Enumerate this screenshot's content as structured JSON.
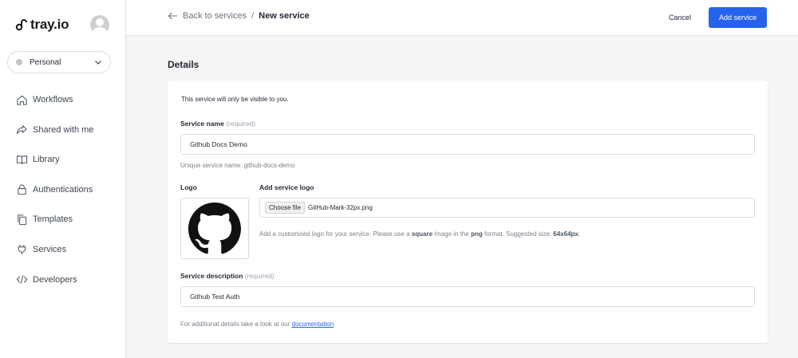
{
  "brand": {
    "name": "tray.io"
  },
  "workspace": {
    "label": "Personal"
  },
  "nav": {
    "items": [
      {
        "label": "Workflows",
        "icon": "home-icon"
      },
      {
        "label": "Shared with me",
        "icon": "share-icon"
      },
      {
        "label": "Library",
        "icon": "book-icon"
      },
      {
        "label": "Authentications",
        "icon": "lock-icon"
      },
      {
        "label": "Templates",
        "icon": "copy-icon"
      },
      {
        "label": "Services",
        "icon": "plug-icon"
      },
      {
        "label": "Developers",
        "icon": "code-icon"
      }
    ]
  },
  "header": {
    "back_label": "Back to services",
    "separator": "/",
    "current": "New service",
    "cancel_label": "Cancel",
    "add_label": "Add service"
  },
  "section": {
    "title": "Details"
  },
  "form": {
    "visibility_note": "This service will only be visible to you.",
    "service_name": {
      "label": "Service name",
      "required": "(required)",
      "value": "Github Docs Demo",
      "unique_prefix": "Unique service name:",
      "unique_value": "github-docs-demo"
    },
    "logo": {
      "label": "Logo",
      "add_label": "Add service logo",
      "choose_label": "Choose file",
      "file_name": "GitHub-Mark-32px.png",
      "help_1": "Add a customised logo for your service. Please use a",
      "help_square": "square",
      "help_2": "image in the",
      "help_png": "png",
      "help_3": "format. Suggested size:",
      "help_size": "64x64px",
      "help_end": "."
    },
    "service_description": {
      "label": "Service description",
      "required": "(required)",
      "value": "Github Test Auth"
    },
    "footer": {
      "text": "For additional details take a look at our",
      "link": "documentation"
    }
  },
  "colors": {
    "accent": "#2563eb",
    "background": "#f5f5f5"
  }
}
